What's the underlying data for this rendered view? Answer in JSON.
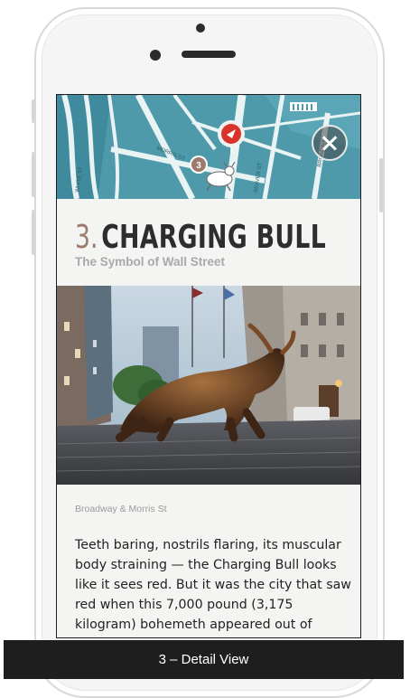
{
  "detail": {
    "number": "3.",
    "title": "CHARGING BULL",
    "subtitle": "The Symbol of Wall Street",
    "address": "Broadway & Morris St",
    "description": "Teeth baring, nostrils flaring, its muscular body straining — the Charging Bull looks like it sees red. But it was the city that saw red when this 7,000 pound (3,175 kilogram) bohemeth appeared out of"
  },
  "map": {
    "marker_label": "3",
    "street_labels": [
      "MORRIS ST",
      "BROADWAY",
      "WHITE ST",
      "BEAVER ST"
    ]
  },
  "icons": {
    "close": "close-icon",
    "marker": "location-marker-icon",
    "bull": "bull-illustration-icon",
    "museum": "building-icon"
  },
  "caption": "3 – Detail View",
  "colors": {
    "map_water": "#4e9aab",
    "accent_red": "#d9322b",
    "title_number": "#9c7b6c",
    "caption_bg": "#1e1e1e"
  }
}
